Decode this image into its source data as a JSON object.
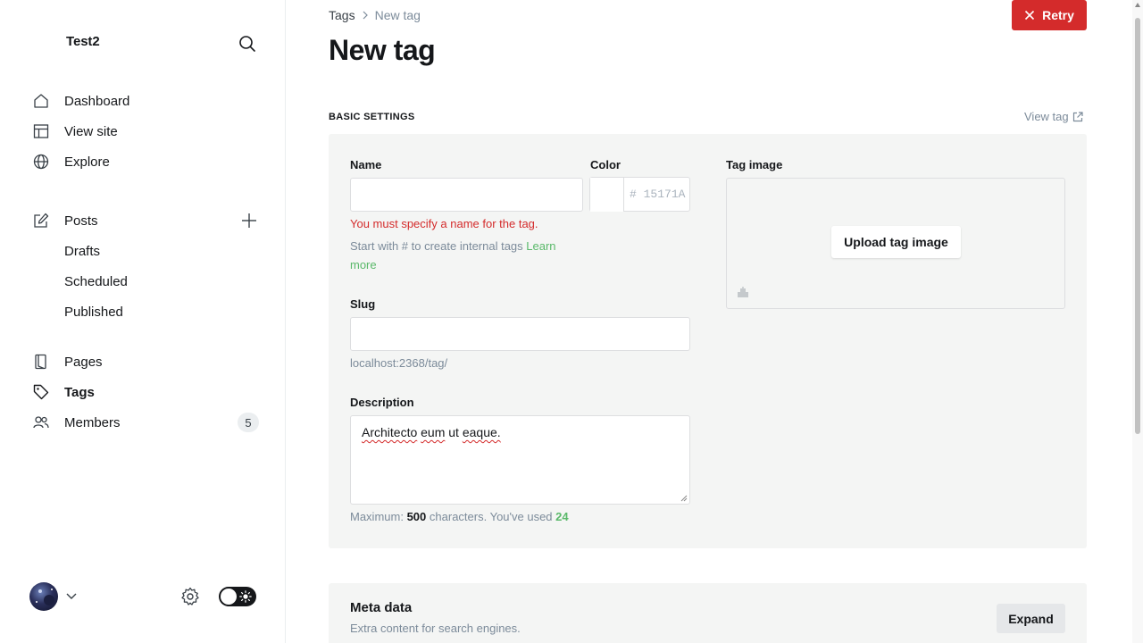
{
  "sidebar": {
    "site_title": "Test2",
    "nav": {
      "dashboard": "Dashboard",
      "view_site": "View site",
      "explore": "Explore",
      "posts": "Posts",
      "drafts": "Drafts",
      "scheduled": "Scheduled",
      "published": "Published",
      "pages": "Pages",
      "tags": "Tags",
      "members": "Members"
    },
    "members_count": "5",
    "icons": {
      "dashboard": "home-icon",
      "view_site": "layout-icon",
      "explore": "globe-icon",
      "posts": "edit-icon",
      "pages": "page-icon",
      "tags": "tag-icon",
      "members": "members-icon"
    }
  },
  "header": {
    "breadcrumb_parent": "Tags",
    "breadcrumb_current": "New tag",
    "title": "New tag",
    "retry_label": "Retry"
  },
  "basic_settings": {
    "section_label": "BASIC SETTINGS",
    "view_tag_label": "View tag",
    "name": {
      "label": "Name",
      "value": "",
      "error": "You must specify a name for the tag.",
      "hint_prefix": "Start with # to create internal tags",
      "hint_link": "Learn more"
    },
    "color": {
      "label": "Color",
      "placeholder": "15171A",
      "hash": "#"
    },
    "tag_image": {
      "label": "Tag image",
      "upload_label": "Upload tag image"
    },
    "slug": {
      "label": "Slug",
      "value": "",
      "url_preview": "localhost:2368/tag/"
    },
    "description": {
      "label": "Description",
      "words": [
        "Architecto",
        "eum",
        "ut",
        "eaque."
      ],
      "counter_prefix": "Maximum:",
      "counter_max": "500",
      "counter_middle": "characters. You've used",
      "counter_used": "24"
    }
  },
  "meta_data": {
    "title": "Meta data",
    "subtitle": "Extra content for search engines.",
    "expand_label": "Expand"
  },
  "colors": {
    "accent_green": "#5ab96a",
    "error_red": "#d42b2b",
    "panel_bg": "#f4f5f4"
  }
}
